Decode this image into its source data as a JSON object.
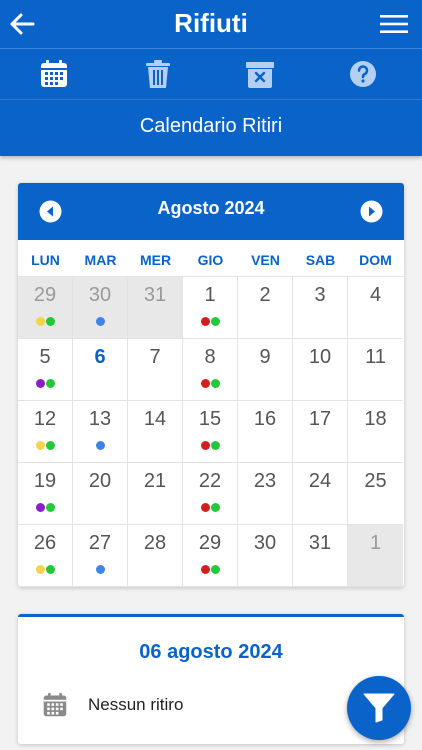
{
  "appbar": {
    "title": "Rifiuti"
  },
  "toolbar": {
    "icons": [
      "calendar-icon",
      "trash-icon",
      "bin-delete-icon",
      "help-icon"
    ]
  },
  "subheader": {
    "title": "Calendario Ritiri"
  },
  "calendar": {
    "month_label": "Agosto 2024",
    "weekdays": [
      "LUN",
      "MAR",
      "MER",
      "GIO",
      "VEN",
      "SAB",
      "DOM"
    ],
    "colors": {
      "yellow": "#f5d547",
      "green": "#22c83a",
      "blue": "#3f83e6",
      "red": "#d21e1e",
      "purple": "#8a1ec9"
    },
    "weeks": [
      [
        {
          "d": "29",
          "other": true,
          "dots": [
            "yellow",
            "green"
          ]
        },
        {
          "d": "30",
          "other": true,
          "dots": [
            "blue"
          ]
        },
        {
          "d": "31",
          "other": true,
          "dots": []
        },
        {
          "d": "1",
          "dots": [
            "red",
            "green"
          ]
        },
        {
          "d": "2",
          "dots": []
        },
        {
          "d": "3",
          "dots": []
        },
        {
          "d": "4",
          "dots": []
        }
      ],
      [
        {
          "d": "5",
          "dots": [
            "purple",
            "green"
          ]
        },
        {
          "d": "6",
          "today": true,
          "dots": []
        },
        {
          "d": "7",
          "dots": []
        },
        {
          "d": "8",
          "dots": [
            "red",
            "green"
          ]
        },
        {
          "d": "9",
          "dots": []
        },
        {
          "d": "10",
          "dots": []
        },
        {
          "d": "11",
          "dots": []
        }
      ],
      [
        {
          "d": "12",
          "dots": [
            "yellow",
            "green"
          ]
        },
        {
          "d": "13",
          "dots": [
            "blue"
          ]
        },
        {
          "d": "14",
          "dots": []
        },
        {
          "d": "15",
          "dots": [
            "red",
            "green"
          ]
        },
        {
          "d": "16",
          "dots": []
        },
        {
          "d": "17",
          "dots": []
        },
        {
          "d": "18",
          "dots": []
        }
      ],
      [
        {
          "d": "19",
          "dots": [
            "purple",
            "green"
          ]
        },
        {
          "d": "20",
          "dots": []
        },
        {
          "d": "21",
          "dots": []
        },
        {
          "d": "22",
          "dots": [
            "red",
            "green"
          ]
        },
        {
          "d": "23",
          "dots": []
        },
        {
          "d": "24",
          "dots": []
        },
        {
          "d": "25",
          "dots": []
        }
      ],
      [
        {
          "d": "26",
          "dots": [
            "yellow",
            "green"
          ]
        },
        {
          "d": "27",
          "dots": [
            "blue"
          ]
        },
        {
          "d": "28",
          "dots": []
        },
        {
          "d": "29",
          "dots": [
            "red",
            "green"
          ]
        },
        {
          "d": "30",
          "dots": []
        },
        {
          "d": "31",
          "dots": []
        },
        {
          "d": "1",
          "other": true,
          "dots": []
        }
      ]
    ]
  },
  "detail": {
    "date": "06 agosto 2024",
    "message": "Nessun ritiro"
  },
  "fab": {
    "icon": "filter-icon"
  }
}
